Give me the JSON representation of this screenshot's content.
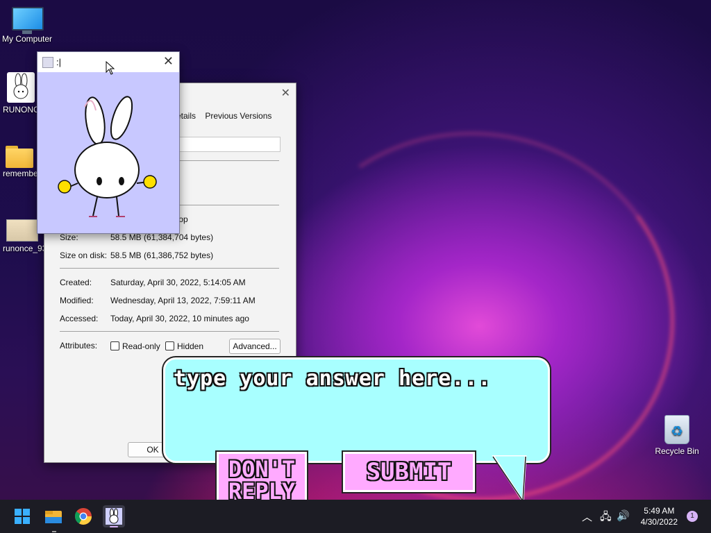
{
  "desktop": {
    "icons": [
      {
        "label": "My Computer",
        "icon": "monitor-icon"
      },
      {
        "label": "RUNONC",
        "icon": "bunny-icon"
      },
      {
        "label": "remembe",
        "icon": "folder-icon"
      },
      {
        "label": "runonce_93",
        "icon": "image-file-icon"
      },
      {
        "label": "Recycle Bin",
        "icon": "recycle-bin-icon"
      }
    ]
  },
  "bunny_window": {
    "title": ":|"
  },
  "properties": {
    "tabs": [
      "etails",
      "Previous Versions"
    ],
    "location_fragment": "top",
    "size_label": "Size:",
    "size_value": "58.5 MB (61,384,704 bytes)",
    "size_on_disk_label": "Size on disk:",
    "size_on_disk_value": "58.5 MB (61,386,752 bytes)",
    "created_label": "Created:",
    "created_value": "Saturday, April 30, 2022, 5:14:05 AM",
    "modified_label": "Modified:",
    "modified_value": "Wednesday, April 13, 2022, 7:59:11 AM",
    "accessed_label": "Accessed:",
    "accessed_value": "Today, April 30, 2022, 10 minutes ago",
    "attributes_label": "Attributes:",
    "readonly_label": "Read-only",
    "hidden_label": "Hidden",
    "advanced_label": "Advanced...",
    "ok_label": "OK"
  },
  "dialog": {
    "placeholder": "type your answer here...",
    "dont_reply_line1": "DON'T",
    "dont_reply_line2": "REPLY",
    "submit_label": "SUBMIT"
  },
  "taskbar": {
    "apps": [
      "windows-start-icon",
      "file-explorer-icon",
      "chrome-icon",
      "bunny-app-icon"
    ],
    "time": "5:49 AM",
    "date": "4/30/2022",
    "notifications": "1"
  }
}
